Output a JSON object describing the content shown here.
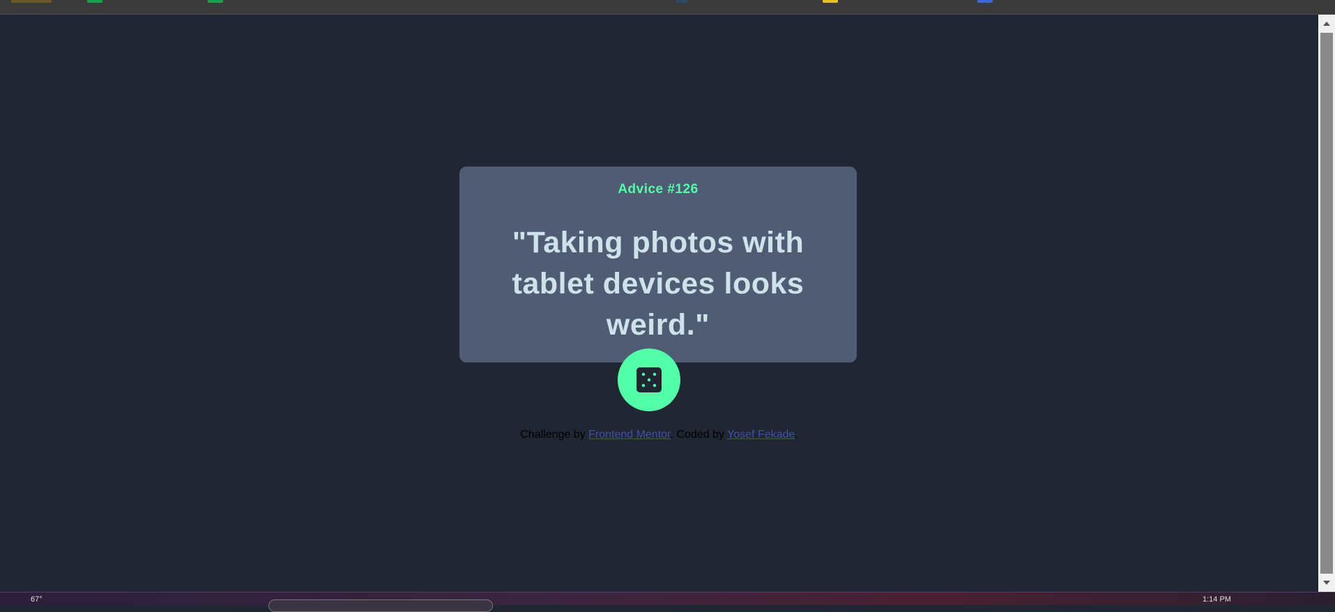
{
  "card": {
    "advice_id": "Advice #126",
    "quote": "\"Taking photos with tablet devices looks weird.\""
  },
  "attribution": {
    "prefix": "Challenge by",
    "challenge_link": "Frontend Mentor",
    "middle": ". Coded by",
    "author_link": "Yosef Fekade",
    "suffix": "."
  },
  "dice_button": {
    "icon": "dice-five-icon"
  },
  "taskbar": {
    "weather": "67°",
    "clock": "1:14 PM"
  },
  "colors": {
    "background": "#202632",
    "card": "#4f5c73",
    "accent": "#52ffa8",
    "quote_text": "#cee3e9",
    "link": "#3e52a3"
  }
}
